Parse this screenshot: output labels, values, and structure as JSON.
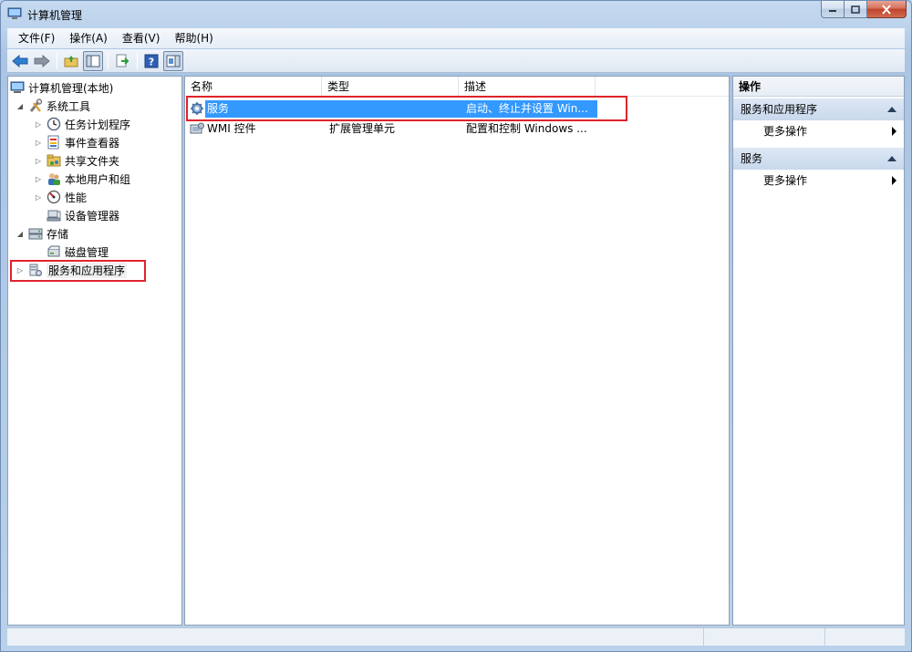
{
  "window": {
    "title": "计算机管理"
  },
  "menu": [
    {
      "label": "文件(F)"
    },
    {
      "label": "操作(A)"
    },
    {
      "label": "查看(V)"
    },
    {
      "label": "帮助(H)"
    }
  ],
  "tree": {
    "root": "计算机管理(本地)",
    "system_tools": "系统工具",
    "task_scheduler": "任务计划程序",
    "event_viewer": "事件查看器",
    "shared_folders": "共享文件夹",
    "local_users": "本地用户和组",
    "performance": "性能",
    "device_manager": "设备管理器",
    "storage": "存储",
    "disk_management": "磁盘管理",
    "services_apps": "服务和应用程序"
  },
  "list": {
    "columns": [
      "名称",
      "类型",
      "描述"
    ],
    "rows": [
      {
        "name": "服务",
        "type": "",
        "desc": "启动、终止并设置 Win..."
      },
      {
        "name": "WMI 控件",
        "type": "扩展管理单元",
        "desc": "配置和控制 Windows ..."
      }
    ]
  },
  "actions": {
    "header": "操作",
    "sections": [
      {
        "title": "服务和应用程序",
        "item": "更多操作"
      },
      {
        "title": "服务",
        "item": "更多操作"
      }
    ]
  },
  "colors": {
    "selection": "#3399ff",
    "annotation_box": "#e0232b"
  }
}
